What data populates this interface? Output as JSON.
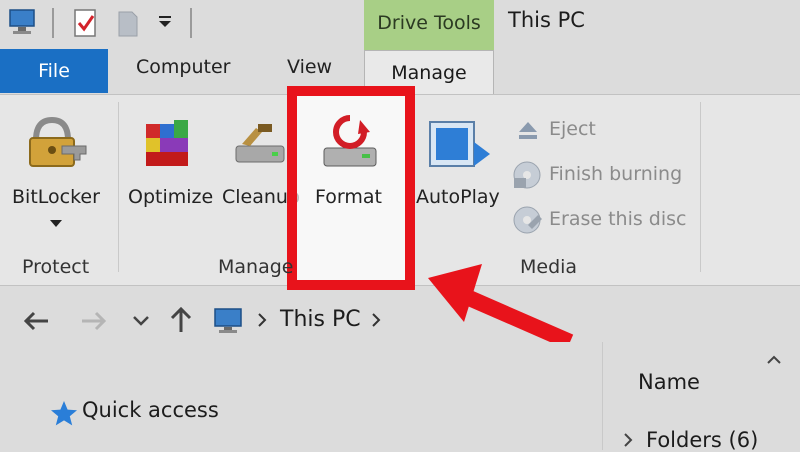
{
  "window": {
    "title": "This PC"
  },
  "context_tab": {
    "label": "Drive Tools"
  },
  "tabs": {
    "file": "File",
    "computer": "Computer",
    "view": "View",
    "manage": "Manage"
  },
  "ribbon": {
    "bitlocker": "BitLocker",
    "optimize": "Optimize",
    "cleanup": "Cleanup",
    "format": "Format",
    "autoplay": "AutoPlay",
    "eject": "Eject",
    "finish_burning": "Finish burning",
    "erase_disc": "Erase this disc",
    "groups": {
      "protect": "Protect",
      "manage": "Manage",
      "media": "Media"
    }
  },
  "address": {
    "path": "This PC"
  },
  "navigation": {
    "quick_access": "Quick access"
  },
  "list": {
    "column_name": "Name",
    "folders": "Folders (6)"
  },
  "colors": {
    "file_tab": "#1a6fc4",
    "context_tab": "#a8cf86",
    "highlight": "#e8131b",
    "arrow": "#e8131b"
  }
}
